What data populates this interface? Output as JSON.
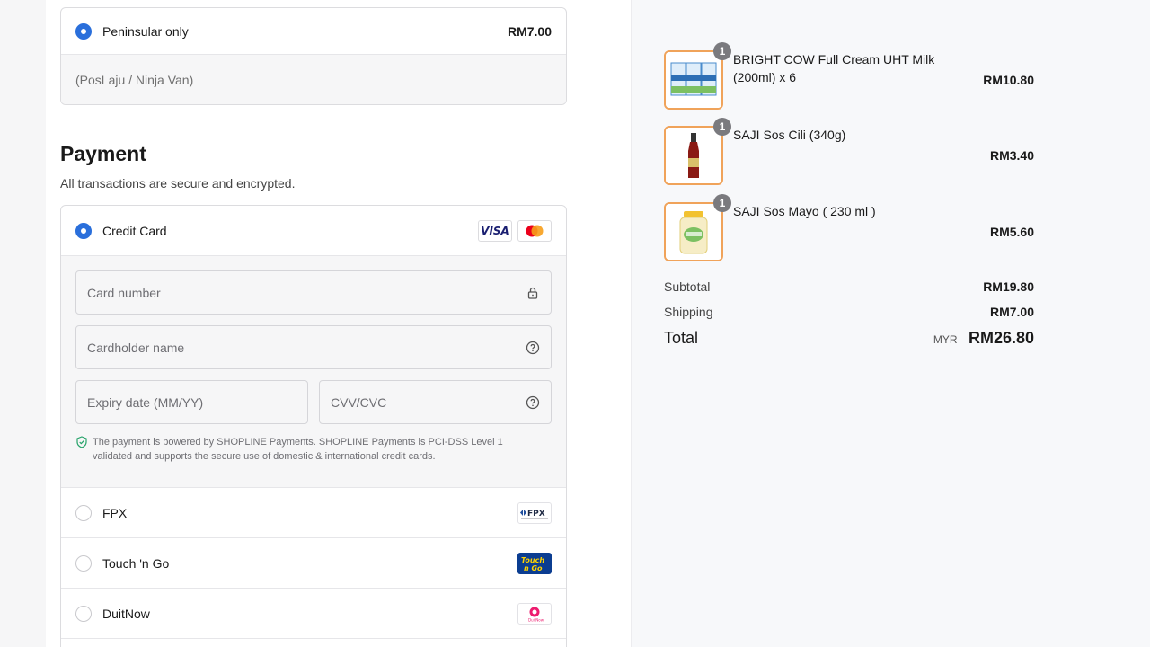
{
  "shipping": {
    "option_label": "Peninsular only",
    "option_price": "RM7.00",
    "option_note": "(PosLaju / Ninja Van)"
  },
  "payment": {
    "title": "Payment",
    "subtitle": "All transactions are secure and encrypted.",
    "credit_card": {
      "label": "Credit Card",
      "card_brands": [
        "VISA",
        "mastercard"
      ],
      "card_number_placeholder": "Card number",
      "cardholder_placeholder": "Cardholder name",
      "expiry_placeholder": "Expiry date (MM/YY)",
      "cvv_placeholder": "CVV/CVC",
      "secure_note": "The payment is powered by SHOPLINE Payments. SHOPLINE Payments is PCI-DSS Level 1 validated and supports the secure use of domestic & international credit cards."
    },
    "options": [
      {
        "label": "FPX",
        "logo": "FPX"
      },
      {
        "label": "Touch 'n Go",
        "logo": "Touch n Go"
      },
      {
        "label": "DuitNow",
        "logo": "DuitNow"
      }
    ]
  },
  "summary": {
    "items": [
      {
        "name": "BRIGHT COW Full Cream UHT Milk (200ml) x 6",
        "price": "RM10.80",
        "qty": "1"
      },
      {
        "name": "SAJI Sos Cili (340g)",
        "price": "RM3.40",
        "qty": "1"
      },
      {
        "name": "SAJI Sos Mayo ( 230 ml )",
        "price": "RM5.60",
        "qty": "1"
      }
    ],
    "subtotal_label": "Subtotal",
    "subtotal_value": "RM19.80",
    "shipping_label": "Shipping",
    "shipping_value": "RM7.00",
    "total_label": "Total",
    "total_currency": "MYR",
    "total_value": "RM26.80"
  },
  "colors": {
    "accent": "#2a6fdb",
    "thumb_border": "#f0a35a"
  }
}
